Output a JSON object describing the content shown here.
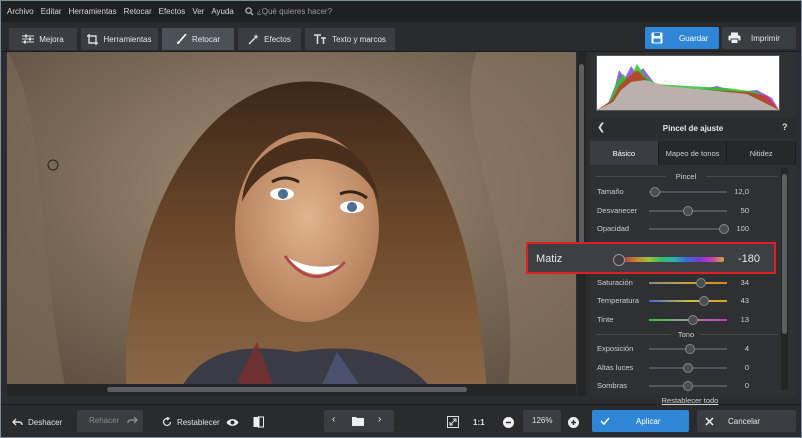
{
  "menu": [
    "Archivo",
    "Editar",
    "Herramientas",
    "Retocar",
    "Efectos",
    "Ver",
    "Ayuda"
  ],
  "search": {
    "placeholder": "¿Qué quieres hacer?"
  },
  "tabs": [
    {
      "label": "Mejora",
      "icon": "sliders-icon"
    },
    {
      "label": "Herramientas",
      "icon": "crop-icon"
    },
    {
      "label": "Retocar",
      "icon": "brush-icon",
      "active": true
    },
    {
      "label": "Efectos",
      "icon": "magic-wand-icon"
    },
    {
      "label": "Texto y marcos",
      "icon": "text-icon"
    }
  ],
  "header_actions": {
    "save": "Guardar",
    "print": "Imprimir"
  },
  "panel": {
    "title": "Pincel de ajuste",
    "help": "?",
    "tabs": [
      "Básico",
      "Mapeo de tonos",
      "Nitidez"
    ],
    "sections": {
      "pincel": "Pincel",
      "tono": "Tono"
    },
    "brush": [
      {
        "label": "Tamaño",
        "value": "12,0",
        "pos": 0.08
      },
      {
        "label": "Desvanecer",
        "value": "50",
        "pos": 0.5
      },
      {
        "label": "Opacidad",
        "value": "100",
        "pos": 0.96
      }
    ],
    "matiz": {
      "label": "Matiz",
      "value": "-180",
      "pos": 0.0
    },
    "color": [
      {
        "label": "Saturación",
        "value": "34",
        "pos": 0.67
      },
      {
        "label": "Temperatura",
        "value": "43",
        "pos": 0.71
      },
      {
        "label": "Tinte",
        "value": "13",
        "pos": 0.56
      }
    ],
    "tone": [
      {
        "label": "Exposición",
        "value": "4",
        "pos": 0.52
      },
      {
        "label": "Altas luces",
        "value": "0",
        "pos": 0.5
      },
      {
        "label": "Sombras",
        "value": "0",
        "pos": 0.5
      }
    ],
    "reset": "Restablecer todo"
  },
  "bottom": {
    "undo": "Deshacer",
    "redo": "Rehacer",
    "reset": "Restablecer",
    "ratio": "1:1",
    "zoom": "126%",
    "apply": "Aplicar",
    "cancel": "Cancelar"
  },
  "colors": {
    "accent": "#2f86d6",
    "highlight": "#e02020"
  }
}
